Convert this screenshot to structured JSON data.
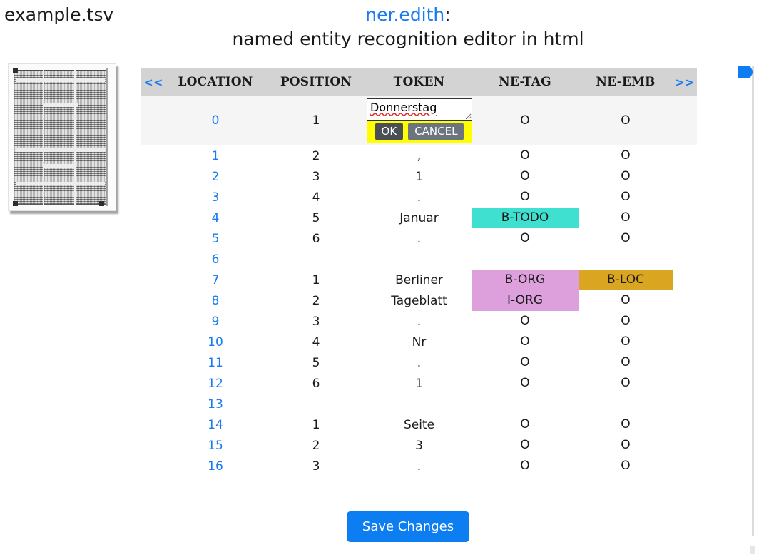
{
  "file": {
    "name": "example.tsv"
  },
  "title": {
    "app": "ner.edith",
    "colon": ":",
    "subtitle": "named entity recognition editor in html"
  },
  "facsimile": {
    "name": "newspaper-page-thumbnail"
  },
  "table": {
    "nav_prev": "<<",
    "nav_next": ">>",
    "columns": [
      "LOCATION",
      "POSITION",
      "TOKEN",
      "NE-TAG",
      "NE-EMB"
    ],
    "rows": [
      {
        "location": "0",
        "position": "1",
        "token": "Donnerstag",
        "netag": "O",
        "neemb": "O",
        "netag_color": "",
        "neemb_color": "",
        "editing": true
      },
      {
        "location": "1",
        "position": "2",
        "token": ",",
        "netag": "O",
        "neemb": "O",
        "netag_color": "",
        "neemb_color": ""
      },
      {
        "location": "2",
        "position": "3",
        "token": "1",
        "netag": "O",
        "neemb": "O",
        "netag_color": "",
        "neemb_color": ""
      },
      {
        "location": "3",
        "position": "4",
        "token": ".",
        "netag": "O",
        "neemb": "O",
        "netag_color": "",
        "neemb_color": ""
      },
      {
        "location": "4",
        "position": "5",
        "token": "Januar",
        "netag": "B-TODO",
        "neemb": "O",
        "netag_color": "#40e0d0",
        "neemb_color": ""
      },
      {
        "location": "5",
        "position": "6",
        "token": ".",
        "netag": "O",
        "neemb": "O",
        "netag_color": "",
        "neemb_color": ""
      },
      {
        "location": "6",
        "position": "",
        "token": "",
        "netag": "",
        "neemb": "",
        "netag_color": "",
        "neemb_color": ""
      },
      {
        "location": "7",
        "position": "1",
        "token": "Berliner",
        "netag": "B-ORG",
        "neemb": "B-LOC",
        "netag_color": "#dda0dd",
        "neemb_color": "#daa520"
      },
      {
        "location": "8",
        "position": "2",
        "token": "Tageblatt",
        "netag": "I-ORG",
        "neemb": "O",
        "netag_color": "#dda0dd",
        "neemb_color": ""
      },
      {
        "location": "9",
        "position": "3",
        "token": ".",
        "netag": "O",
        "neemb": "O",
        "netag_color": "",
        "neemb_color": ""
      },
      {
        "location": "10",
        "position": "4",
        "token": "Nr",
        "netag": "O",
        "neemb": "O",
        "netag_color": "",
        "neemb_color": ""
      },
      {
        "location": "11",
        "position": "5",
        "token": ".",
        "netag": "O",
        "neemb": "O",
        "netag_color": "",
        "neemb_color": ""
      },
      {
        "location": "12",
        "position": "6",
        "token": "1",
        "netag": "O",
        "neemb": "O",
        "netag_color": "",
        "neemb_color": ""
      },
      {
        "location": "13",
        "position": "",
        "token": "",
        "netag": "",
        "neemb": "",
        "netag_color": "",
        "neemb_color": ""
      },
      {
        "location": "14",
        "position": "1",
        "token": "Seite",
        "netag": "O",
        "neemb": "O",
        "netag_color": "",
        "neemb_color": ""
      },
      {
        "location": "15",
        "position": "2",
        "token": "3",
        "netag": "O",
        "neemb": "O",
        "netag_color": "",
        "neemb_color": ""
      },
      {
        "location": "16",
        "position": "3",
        "token": ".",
        "netag": "O",
        "neemb": "O",
        "netag_color": "",
        "neemb_color": ""
      }
    ]
  },
  "editor": {
    "value": "Donnerstag",
    "ok_label": "OK",
    "cancel_label": "CANCEL",
    "highlight_color": "#ffff00"
  },
  "footer": {
    "save_label": "Save Changes",
    "save_color": "#0d7df2"
  },
  "rail": {
    "marker_name": "position-flag",
    "marker_color": "#0d7df2"
  }
}
